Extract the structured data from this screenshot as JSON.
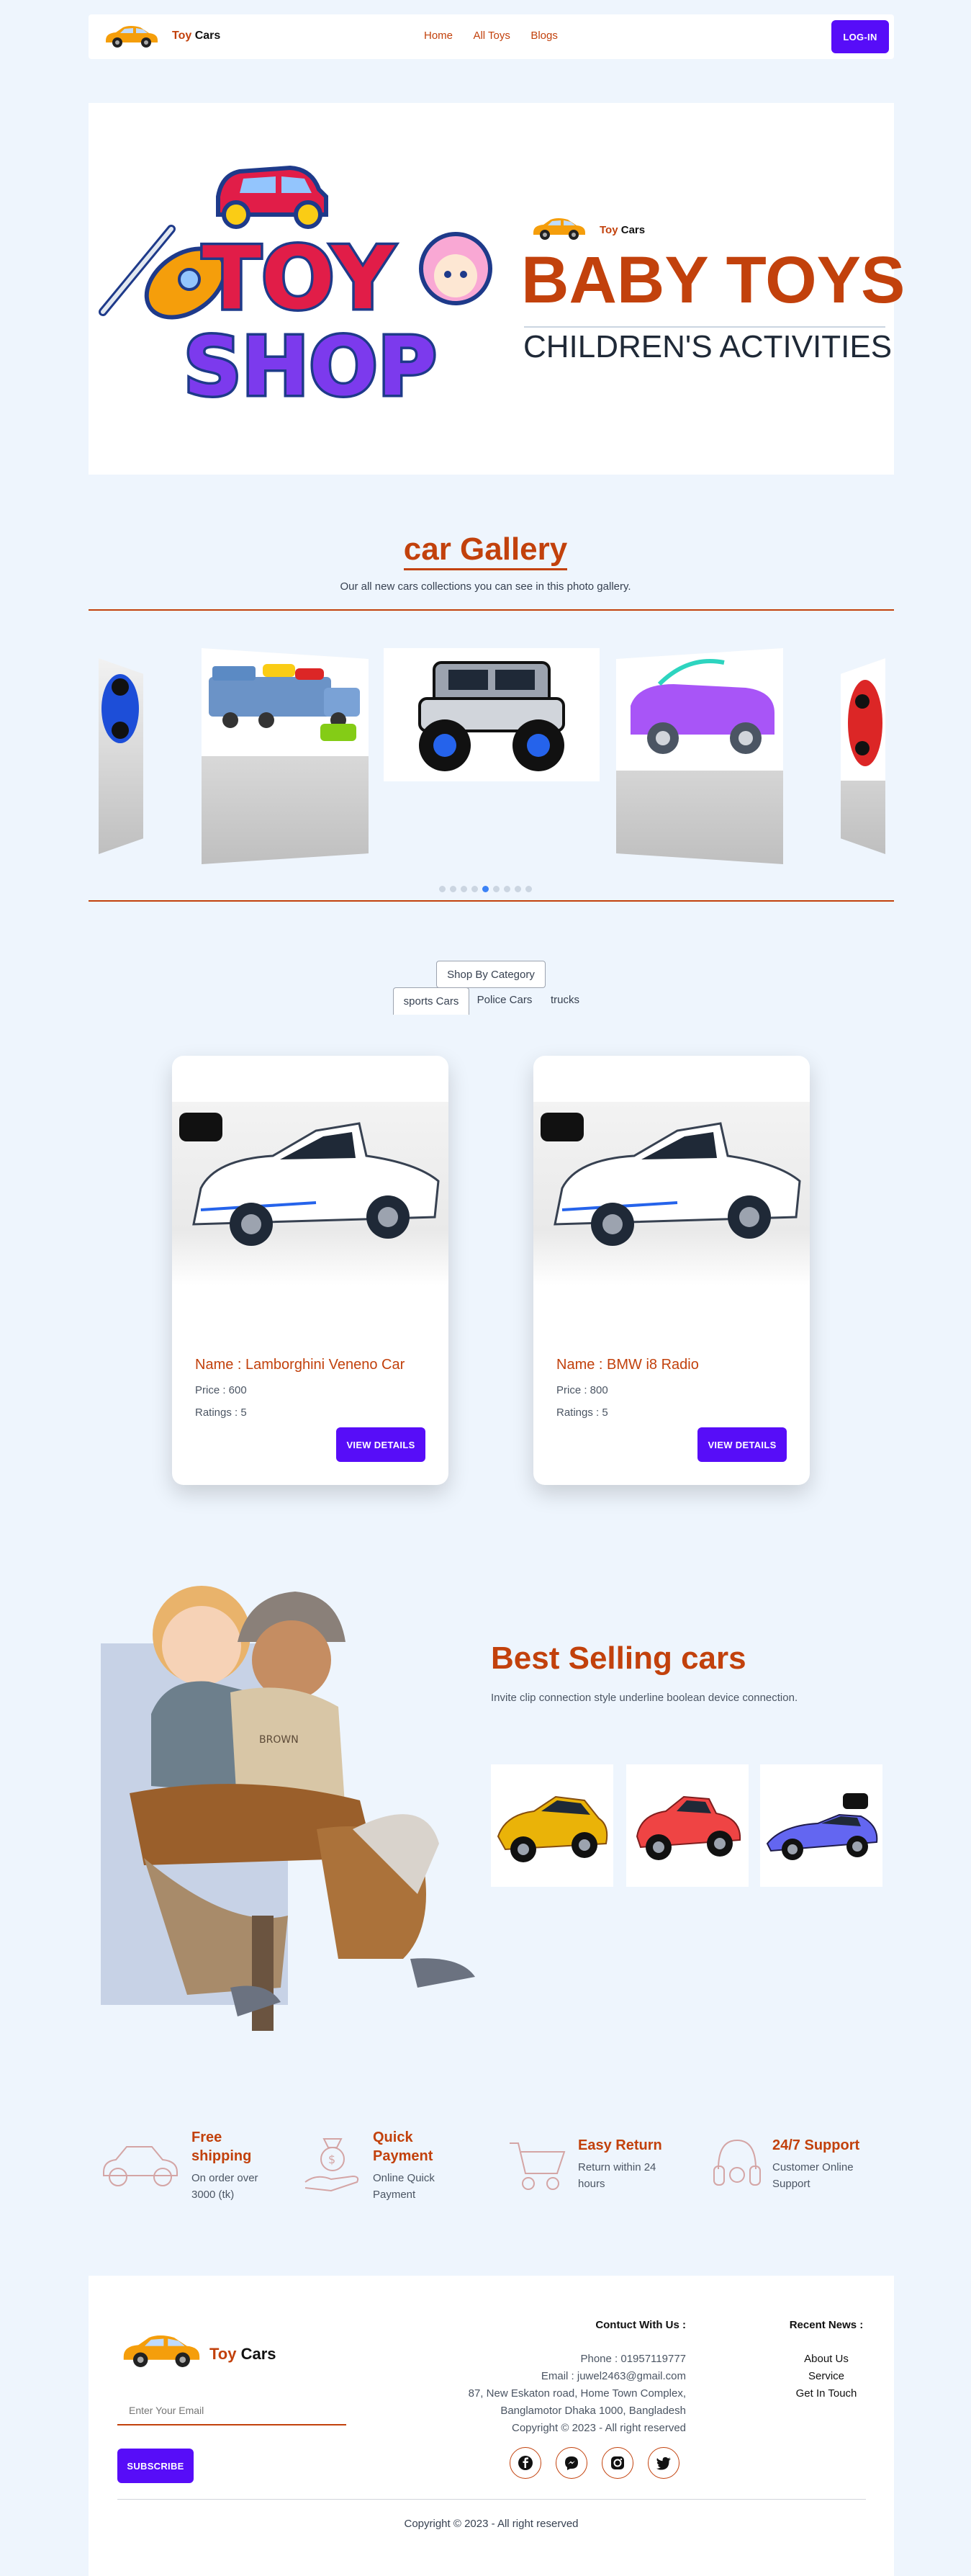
{
  "nav": {
    "brand_toy": "Toy",
    "brand_cars": "Cars",
    "links": [
      "Home",
      "All Toys",
      "Blogs"
    ],
    "login": "LOG-IN"
  },
  "hero": {
    "logo_line1": "TOY",
    "logo_line2": "SHOP",
    "brand_toy": "Toy",
    "brand_cars": "Cars",
    "headline": "BABY TOYS",
    "subheadline": "CHILDREN'S ACTIVITIES"
  },
  "gallery": {
    "title": "car Gallery",
    "subtitle": "Our all new cars collections you can see in this photo gallery.",
    "dots_total": 9,
    "active_dot": 4
  },
  "category": {
    "button": "Shop By Category",
    "tabs": [
      "sports Cars",
      "Police Cars",
      "trucks"
    ],
    "active_tab": 0
  },
  "products": [
    {
      "name": "Name : Lamborghini Veneno Car",
      "price": "Price : 600",
      "ratings": "Ratings : 5",
      "cta": "VIEW DETAILS"
    },
    {
      "name": "Name : BMW i8 Radio",
      "price": "Price : 800",
      "ratings": "Ratings : 5",
      "cta": "VIEW DETAILS"
    }
  ],
  "best": {
    "title": "Best Selling cars",
    "text": "Invite clip connection style underline boolean device connection.",
    "kid_sweater": "BROWN"
  },
  "features": [
    {
      "title": "Free shipping",
      "text": "On order over 3000 (tk)",
      "icon": "car-icon"
    },
    {
      "title": "Quick Payment",
      "text": "Online Quick Payment",
      "icon": "money-bag-icon"
    },
    {
      "title": "Easy Return",
      "text": "Return within 24 hours",
      "icon": "cart-icon"
    },
    {
      "title": "24/7 Support",
      "text": "Customer Online Support",
      "icon": "headset-icon"
    }
  ],
  "footer": {
    "brand_toy": "Toy",
    "brand_cars": "Cars",
    "email_placeholder": "Enter Your Email",
    "subscribe": "SUBSCRIBE",
    "contact_title": "Contuct With Us :",
    "contact_lines": [
      "Phone : 01957119777",
      "Email : juwel2463@gmail.com",
      "87, New Eskaton road, Home Town Complex,",
      "Banglamotor Dhaka 1000, Bangladesh",
      "Copyright © 2023 - All right reserved"
    ],
    "news_title": "Recent News :",
    "news_links": [
      "About Us",
      "Service",
      "Get In Touch"
    ],
    "socials": [
      "facebook-icon",
      "messenger-icon",
      "instagram-icon",
      "twitter-icon"
    ],
    "copyright": "Copyright © 2023 - All right reserved"
  }
}
